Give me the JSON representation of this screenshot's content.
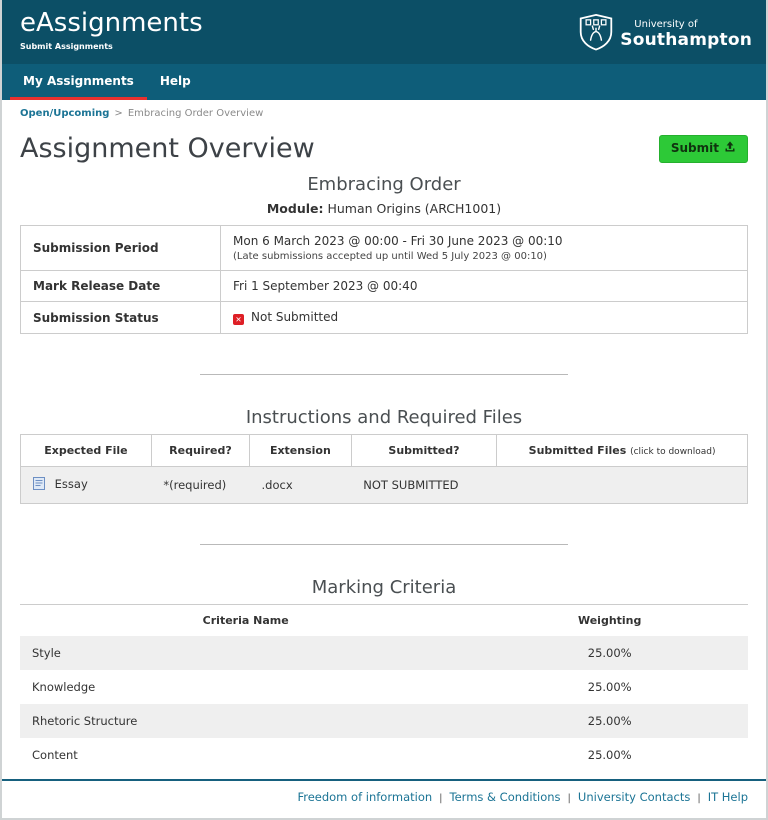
{
  "header": {
    "app_title": "eAssignments",
    "app_subtitle": "Submit Assignments",
    "logo_line1": "University of",
    "logo_line2": "Southampton"
  },
  "nav": {
    "items": [
      {
        "label": "My Assignments",
        "active": true
      },
      {
        "label": "Help",
        "active": false
      }
    ]
  },
  "breadcrumb": {
    "link": "Open/Upcoming",
    "separator": ">",
    "current": "Embracing Order Overview"
  },
  "overview": {
    "title": "Assignment Overview",
    "submit_label": "Submit"
  },
  "assignment": {
    "title": "Embracing Order",
    "module_label": "Module:",
    "module_value": "Human Origins (ARCH1001)",
    "rows": [
      {
        "label": "Submission Period",
        "value": "Mon 6 March 2023 @ 00:00 - Fri 30 June 2023 @ 00:10",
        "note": "(Late submissions accepted up until Wed 5 July 2023 @ 00:10)"
      },
      {
        "label": "Mark Release Date",
        "value": "Fri 1 September 2023 @ 00:40"
      },
      {
        "label": "Submission Status",
        "value": "Not Submitted",
        "status_icon": "x"
      }
    ]
  },
  "files": {
    "title": "Instructions and Required Files",
    "headers": [
      "Expected File",
      "Required?",
      "Extension",
      "Submitted?"
    ],
    "last_header_main": "Submitted Files",
    "last_header_hint": "(click to download)",
    "rows": [
      {
        "file": "Essay",
        "required": "*(required)",
        "extension": ".docx",
        "submitted": "NOT SUBMITTED",
        "submitted_files": ""
      }
    ]
  },
  "criteria": {
    "title": "Marking Criteria",
    "headers": [
      "Criteria Name",
      "Weighting"
    ],
    "rows": [
      {
        "name": "Style",
        "weighting": "25.00%"
      },
      {
        "name": "Knowledge",
        "weighting": "25.00%"
      },
      {
        "name": "Rhetoric Structure",
        "weighting": "25.00%"
      },
      {
        "name": "Content",
        "weighting": "25.00%"
      }
    ]
  },
  "footer": {
    "separator": "|",
    "links": [
      "Freedom of information",
      "Terms & Conditions",
      "University Contacts",
      "IT Help"
    ]
  },
  "colors": {
    "header_bg": "#0c4f66",
    "nav_bg": "#0e5d79",
    "accent_red": "#e8302e",
    "submit_green": "#2dc937",
    "link_teal": "#1b7495",
    "status_red": "#de1f26",
    "row_alt_gray": "#efefef"
  }
}
